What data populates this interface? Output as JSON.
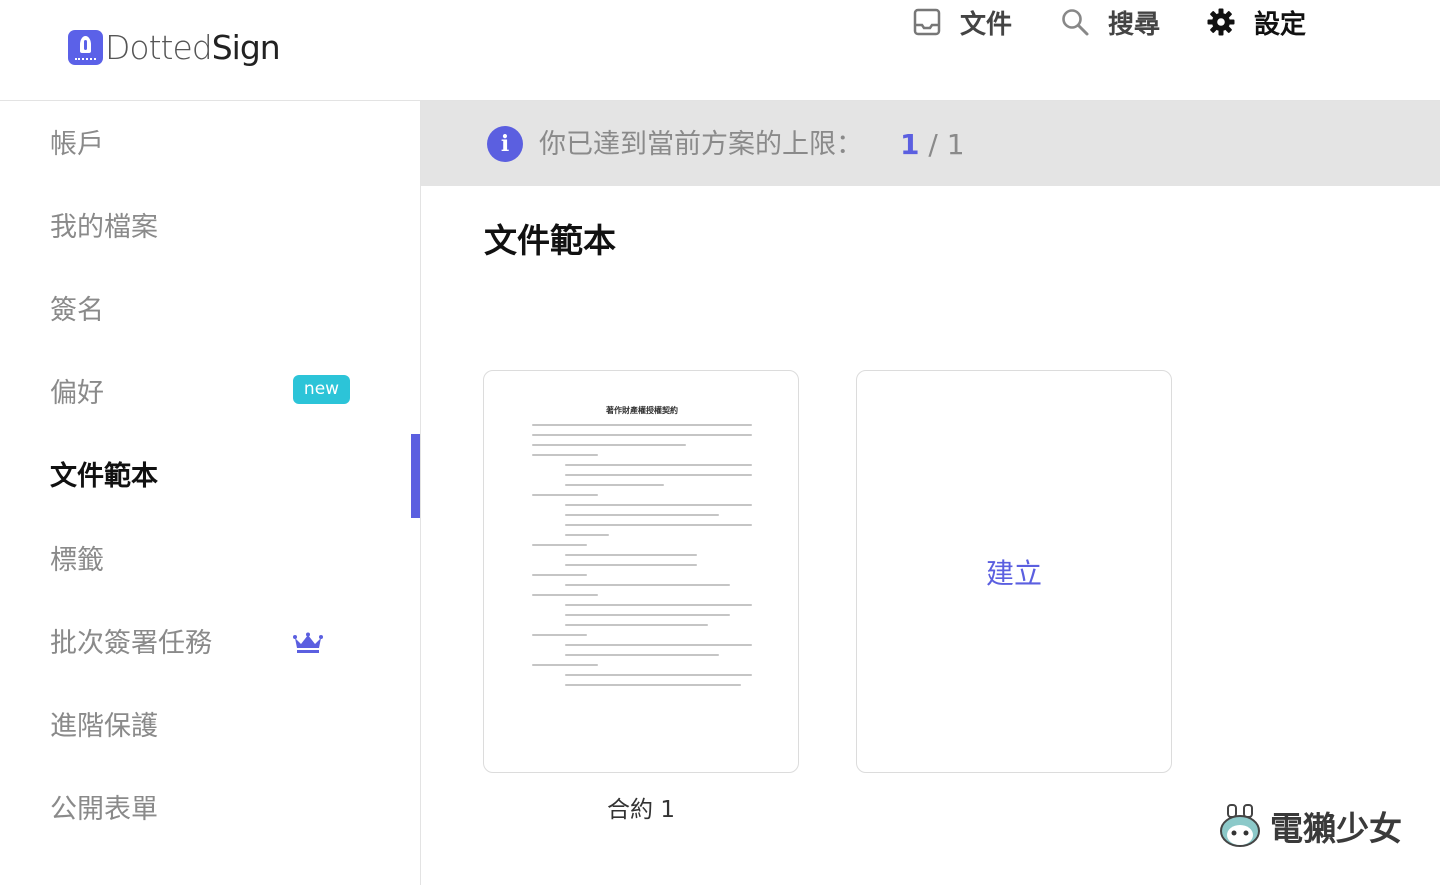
{
  "app": {
    "logo_text_light": "Dotted",
    "logo_text_bold": "Sign",
    "brand_color": "#5b5fe0"
  },
  "nav": {
    "documents": "文件",
    "search": "搜尋",
    "settings": "設定"
  },
  "sidebar": {
    "items": [
      {
        "label": "帳戶"
      },
      {
        "label": "我的檔案"
      },
      {
        "label": "簽名"
      },
      {
        "label": "偏好"
      },
      {
        "label": "文件範本"
      },
      {
        "label": "標籤"
      },
      {
        "label": "批次簽署任務"
      },
      {
        "label": "進階保護"
      },
      {
        "label": "公開表單"
      }
    ],
    "active_item": "文件範本",
    "new_badge": "new"
  },
  "banner": {
    "message": "你已達到當前方案的上限：",
    "used": "1",
    "separator": " / ",
    "limit": "1"
  },
  "main": {
    "title": "文件範本",
    "template_card": {
      "caption": "合約 1",
      "preview_title": "著作財產權授權契約"
    },
    "create_label": "建立"
  },
  "watermark": {
    "text": "電獺少女"
  }
}
